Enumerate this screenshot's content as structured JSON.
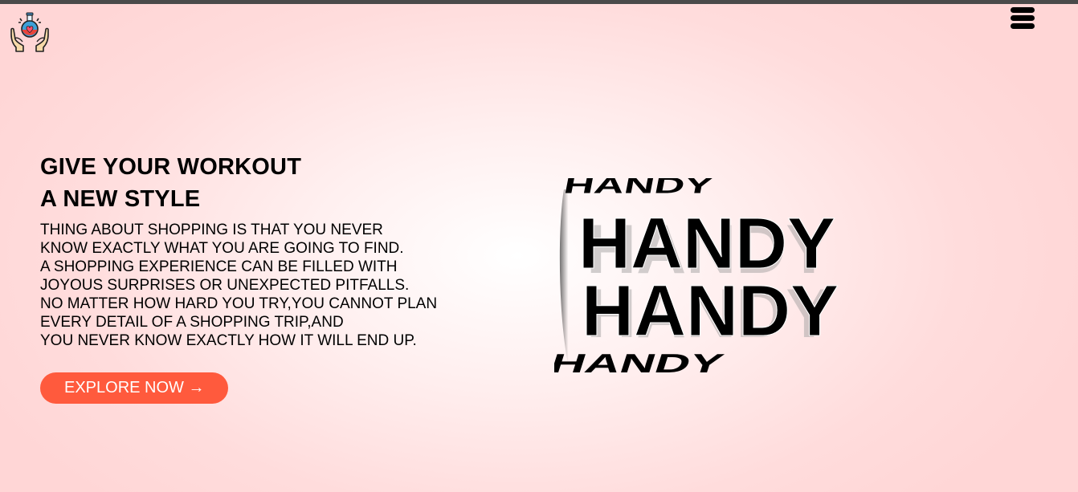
{
  "header": {
    "logo_icon": "potion-in-hands-icon",
    "menu_icon": "hamburger-menu-icon"
  },
  "hero": {
    "heading_lines": [
      "GIVE YOUR WORKOUT",
      "A NEW STYLE"
    ],
    "body_lines": [
      "THING ABOUT SHOPPING IS THAT YOU NEVER",
      "KNOW EXACTLY WHAT YOU ARE GOING TO FIND.",
      "A SHOPPING EXPERIENCE CAN BE FILLED WITH",
      "JOYOUS SURPRISES OR UNEXPECTED PITFALLS.",
      "NO MATTER HOW HARD YOU TRY,YOU CANNOT PLAN",
      "EVERY DETAIL OF A SHOPPING TRIP,AND",
      "YOU NEVER KNOW EXACTLY HOW IT WILL END UP."
    ],
    "cta_label": "EXPLORE NOW →"
  },
  "art": {
    "word": "HANDY"
  },
  "colors": {
    "accent": "#ff5a3d",
    "topbar": "#4a4a4a",
    "background": "#ffdcdc"
  }
}
